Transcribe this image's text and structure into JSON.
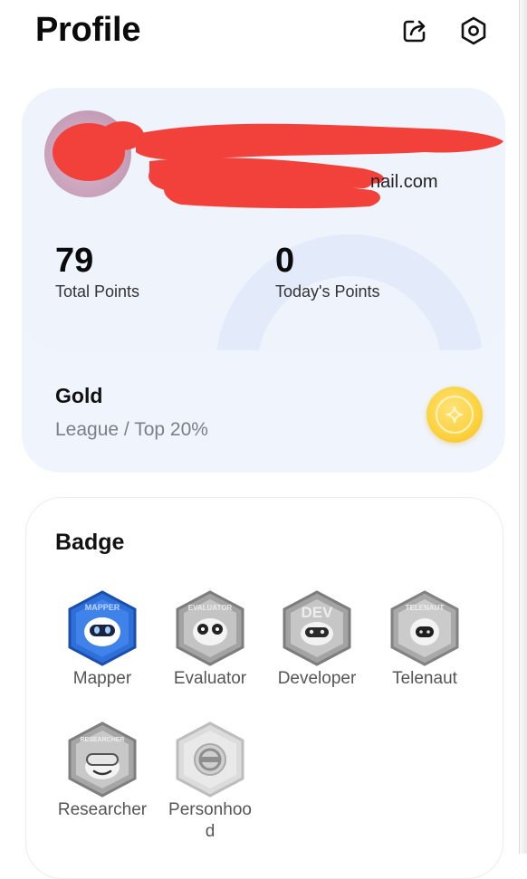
{
  "header": {
    "title": "Profile",
    "share_icon": "share-icon",
    "settings_icon": "settings-icon"
  },
  "profile": {
    "email_fragment": "nail.com",
    "total_points": "79",
    "total_points_label": "Total Points",
    "today_points": "0",
    "today_points_label": "Today's Points",
    "name_redacted": true
  },
  "league": {
    "name": "Gold",
    "subtitle": "League / Top 20%",
    "icon": "gold-coin-icon",
    "color": "#fcd23f"
  },
  "badges": {
    "title": "Badge",
    "items": [
      {
        "label": "Mapper",
        "ring": "MAPPER",
        "color": "#2f6fd9"
      },
      {
        "label": "Evaluator",
        "ring": "EVALUATOR",
        "color": "#9a9a9a"
      },
      {
        "label": "Developer",
        "ring": "DEV",
        "color": "#9a9a9a"
      },
      {
        "label": "Telenaut",
        "ring": "TELENAUT",
        "color": "#9a9a9a"
      },
      {
        "label": "Researcher",
        "ring": "RESEARCHER",
        "color": "#9a9a9a"
      },
      {
        "label": "Personhoo\nd",
        "ring": "",
        "color": "#b5b5b5"
      }
    ]
  }
}
